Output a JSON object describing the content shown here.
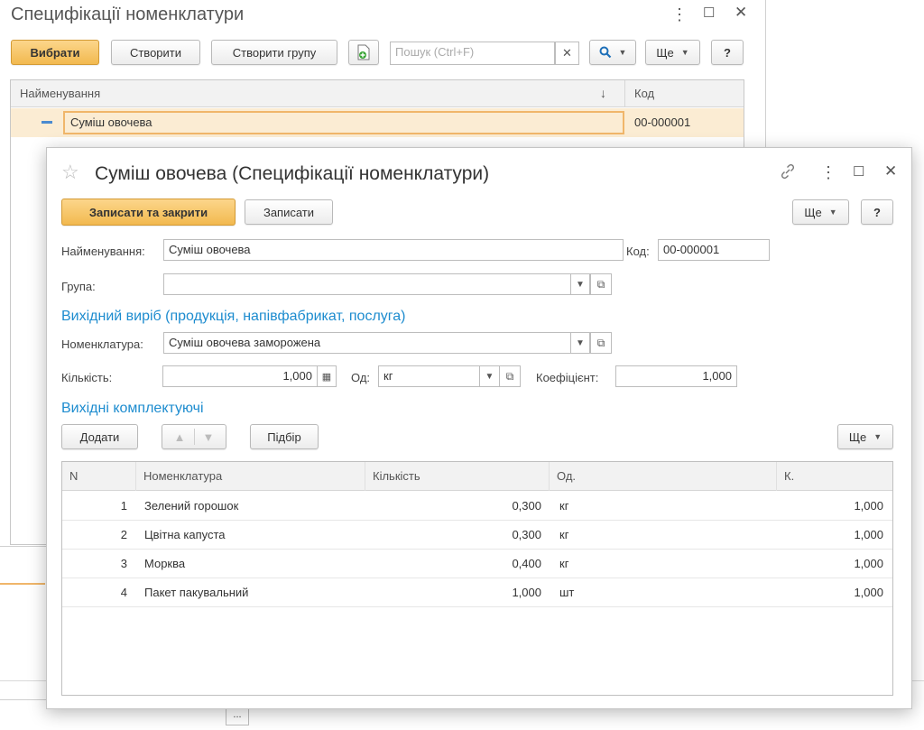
{
  "list_window": {
    "title": "Специфікації номенклатури",
    "toolbar": {
      "select_label": "Вибрати",
      "create_label": "Створити",
      "create_group_label": "Створити групу",
      "search_placeholder": "Пошук (Ctrl+F)",
      "more_label": "Ще",
      "help_label": "?"
    },
    "columns": {
      "name": "Найменування",
      "code": "Код"
    },
    "rows": [
      {
        "name": "Суміш овочева",
        "code": "00-000001"
      }
    ]
  },
  "dialog": {
    "title": "Суміш овочева (Специфікації номенклатури)",
    "toolbar": {
      "save_close_label": "Записати та закрити",
      "save_label": "Записати",
      "more_label": "Ще",
      "help_label": "?"
    },
    "form": {
      "name_label": "Найменування:",
      "name_value": "Суміш овочева",
      "code_label": "Код:",
      "code_value": "00-000001",
      "group_label": "Група:",
      "group_value": ""
    },
    "output_section": {
      "title": "Вихідний виріб (продукція, напівфабрикат, послуга)",
      "nomenclature_label": "Номенклатура:",
      "nomenclature_value": "Суміш овочева заморожена",
      "quantity_label": "Кількість:",
      "quantity_value": "1,000",
      "unit_label": "Од:",
      "unit_value": "кг",
      "coef_label": "Коефіцієнт:",
      "coef_value": "1,000"
    },
    "components_section": {
      "title": "Вихідні комплектуючі",
      "add_label": "Додати",
      "pick_label": "Підбір",
      "more_label": "Ще"
    },
    "table": {
      "columns": {
        "n": "N",
        "nomenclature": "Номенклатура",
        "quantity": "Кількість",
        "unit": "Од.",
        "k": "К."
      },
      "rows": [
        {
          "n": "1",
          "nomenclature": "Зелений горошок",
          "quantity": "0,300",
          "unit": "кг",
          "k": "1,000"
        },
        {
          "n": "2",
          "nomenclature": "Цвітна капуста",
          "quantity": "0,300",
          "unit": "кг",
          "k": "1,000"
        },
        {
          "n": "3",
          "nomenclature": "Морква",
          "quantity": "0,400",
          "unit": "кг",
          "k": "1,000"
        },
        {
          "n": "4",
          "nomenclature": "Пакет пакувальний",
          "quantity": "1,000",
          "unit": "шт",
          "k": "1,000"
        }
      ]
    }
  },
  "bottom_button_label": "..."
}
